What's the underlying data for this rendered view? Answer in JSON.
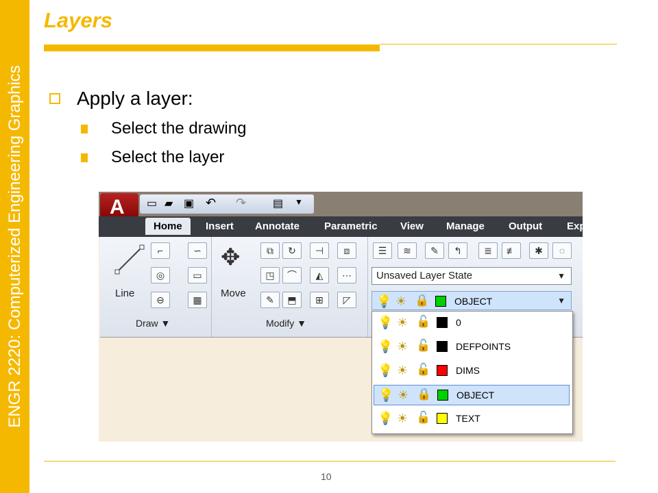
{
  "sidebar": {
    "text": "ENGR 2220: Computerized Engineering Graphics"
  },
  "title": "Layers",
  "bullets": {
    "main": "Apply a layer:",
    "sub": [
      "Select the drawing",
      "Select the layer"
    ]
  },
  "screenshot": {
    "tabs": [
      "Home",
      "Insert",
      "Annotate",
      "Parametric",
      "View",
      "Manage",
      "Output",
      "Exp"
    ],
    "active_tab": "Home",
    "draw_tool": "Line",
    "modify_tool": "Move",
    "panels": {
      "draw": "Draw ▼",
      "modify": "Modify ▼"
    },
    "layer_state": "Unsaved Layer State",
    "current_layer": "OBJECT",
    "layers": [
      {
        "name": "0",
        "color": "#000000"
      },
      {
        "name": "DEFPOINTS",
        "color": "#000000"
      },
      {
        "name": "DIMS",
        "color": "#ff0000"
      },
      {
        "name": "OBJECT",
        "color": "#00d000"
      },
      {
        "name": "TEXT",
        "color": "#ffff00"
      }
    ]
  },
  "page_number": "10",
  "colors": {
    "accent": "#f5b800"
  }
}
